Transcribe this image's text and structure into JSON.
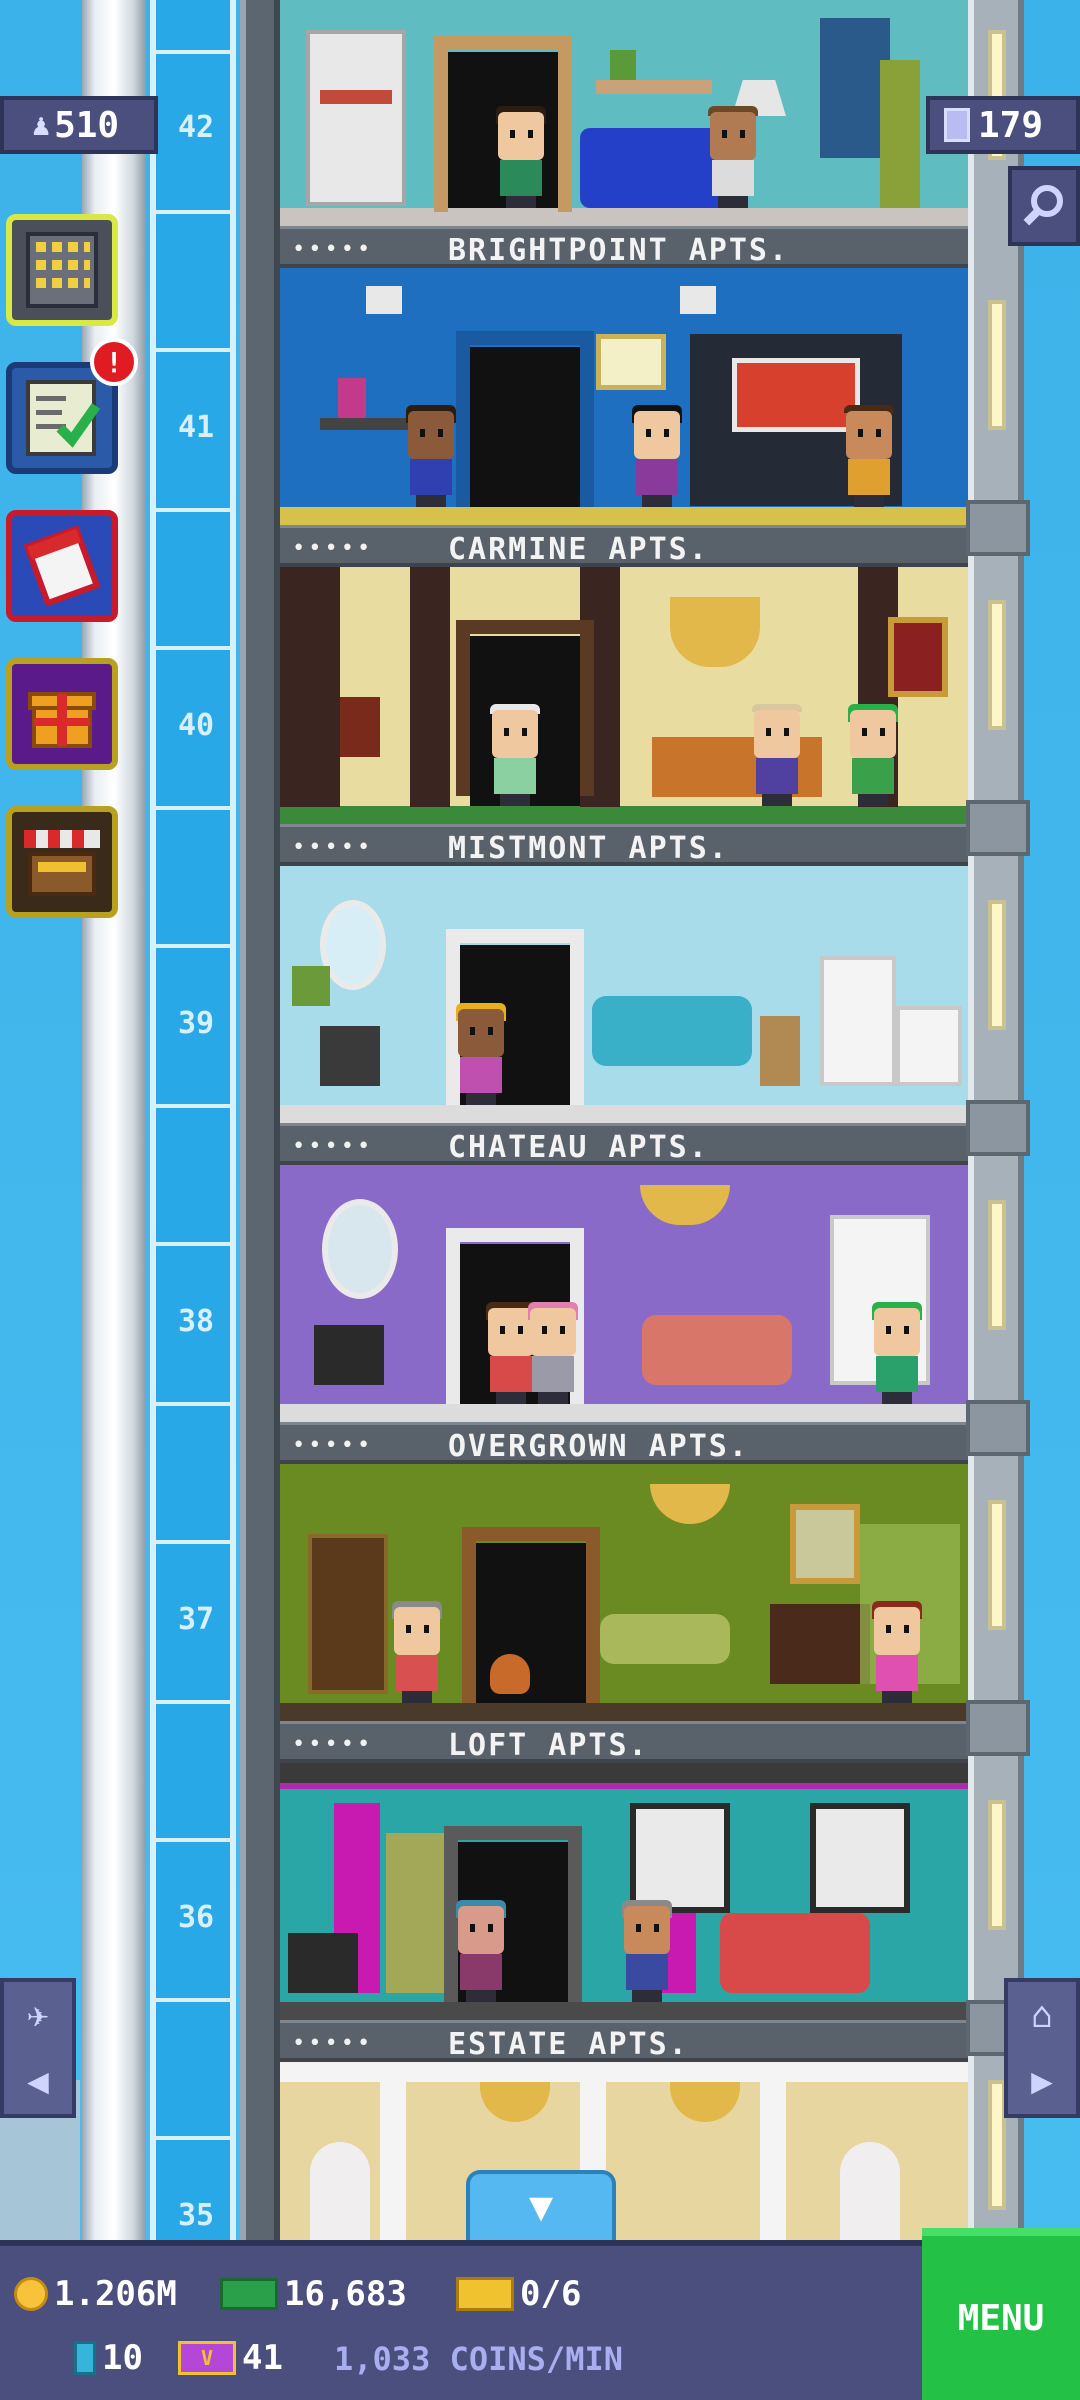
{
  "hud": {
    "population": "510",
    "floors": "179"
  },
  "floor_numbers": [
    "42",
    "41",
    "40",
    "39",
    "38",
    "37",
    "36",
    "35"
  ],
  "floors": [
    {
      "stars": "•••••",
      "name": "BRIGHTPOINT APTS."
    },
    {
      "stars": "•••••",
      "name": "CARMINE APTS."
    },
    {
      "stars": "•••••",
      "name": "MISTMONT APTS."
    },
    {
      "stars": "•••••",
      "name": "CHATEAU APTS."
    },
    {
      "stars": "•••••",
      "name": "OVERGROWN APTS."
    },
    {
      "stars": "•••••",
      "name": "LOFT APTS."
    },
    {
      "stars": "•••••",
      "name": "ESTATE APTS."
    }
  ],
  "side_buttons": {
    "notification_count": "!"
  },
  "bottom": {
    "coins": "1.206M",
    "bux": "16,683",
    "tickets": "0/6",
    "cells": "10",
    "vip": "41",
    "rate": "1,033 COINS/MIN",
    "menu_label": "MENU",
    "vip_icon_text": "V"
  },
  "colors": {
    "hud_panel": "#4a4f7d",
    "menu_green": "#23c247",
    "sky": "#3fb4ec"
  }
}
